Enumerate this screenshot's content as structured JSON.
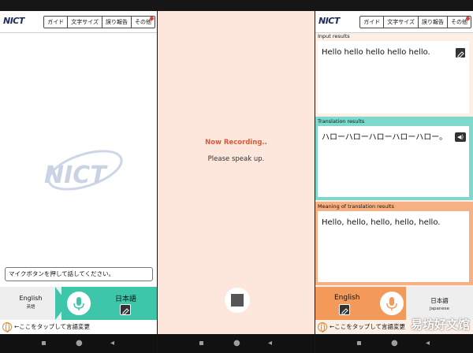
{
  "header": {
    "logo_text": "NICT",
    "menu": [
      "ガイド",
      "文字サイズ",
      "誤り報告",
      "その他"
    ]
  },
  "screen1": {
    "watermark_logo": "NICT",
    "hint": "マイクボタンを押して話してください。",
    "source_lang": {
      "name": "English",
      "sub": "英語"
    },
    "target_lang": {
      "name": "日本語"
    },
    "tap_hint": "←ここをタップして言語変更"
  },
  "screen2": {
    "status": "Now Recording..",
    "prompt": "Please speak up."
  },
  "screen3": {
    "input_label": "Input results",
    "input_text": "Hello hello hello hello hello.",
    "translation_label": "Translation results",
    "translation_text": "ハローハローハローハローハロー。",
    "meaning_label": "Meaning of translation results",
    "meaning_text": "Hello, hello, hello, hello, hello.",
    "source_lang": {
      "name": "English"
    },
    "target_lang": {
      "name": "日本語",
      "sub": "Japanese"
    },
    "tap_hint": "←ここをタップして言語変更"
  },
  "overlay_watermark": "易坊好文馆",
  "colors": {
    "teal": "#3ec6aa",
    "orange": "#f39a5a",
    "recording_red": "#d9593a",
    "logo_navy": "#1c2a5e"
  }
}
